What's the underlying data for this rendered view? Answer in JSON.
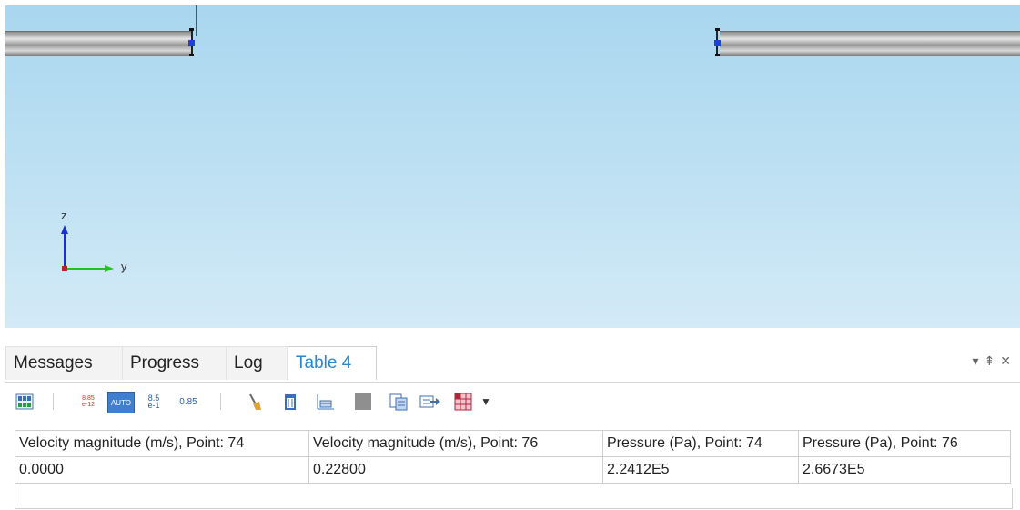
{
  "axes": {
    "z_label": "z",
    "y_label": "y"
  },
  "panel": {
    "tabs": [
      {
        "label": "Messages"
      },
      {
        "label": "Progress"
      },
      {
        "label": "Log"
      },
      {
        "label": "Table 4"
      }
    ],
    "active_tab": "Table 4",
    "toolbar": {
      "number_format_buttons": [
        "8.85\ne-12",
        "AUTO",
        "8.5\ne-1",
        "0.85"
      ]
    }
  },
  "table": {
    "headers": [
      "Velocity magnitude (m/s), Point: 74",
      "Velocity magnitude (m/s), Point: 76",
      "Pressure (Pa), Point: 74",
      "Pressure (Pa), Point: 76"
    ],
    "rows": [
      [
        "0.0000",
        "0.22800",
        "2.2412E5",
        "2.6673E5"
      ]
    ]
  },
  "colors": {
    "accent": "#2b87c9",
    "viewport_top": "#a9d6ef",
    "viewport_bottom": "#d3eaf7",
    "point_marker": "#1f3fe0"
  }
}
